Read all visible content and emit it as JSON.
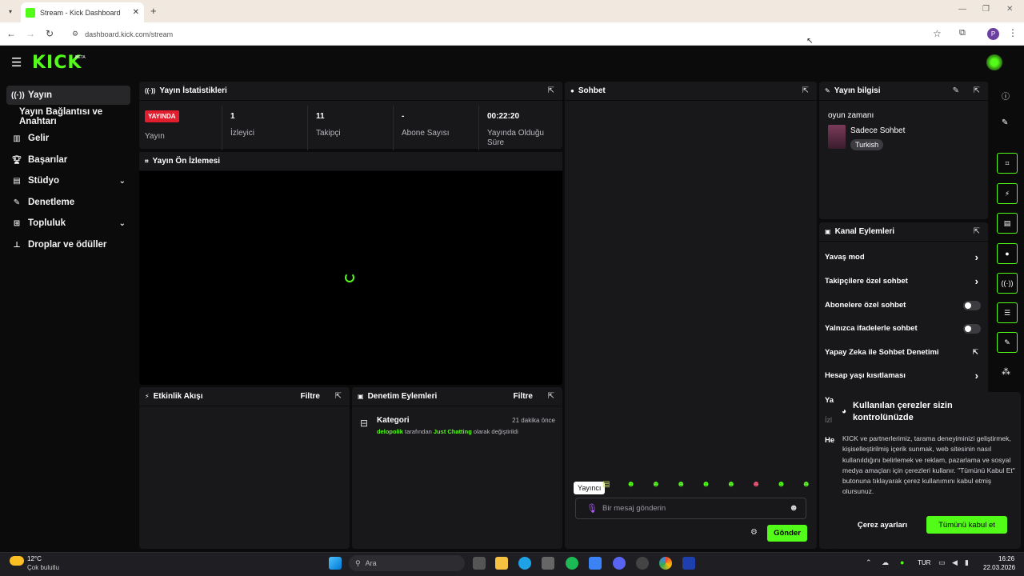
{
  "browser": {
    "tab_title": "Stream - Kick Dashboard",
    "url": "dashboard.kick.com/stream",
    "profile_initial": "P"
  },
  "app": {
    "logo": "KICK",
    "logo_badge": "BETA"
  },
  "sidebar": {
    "items": [
      {
        "label": "Yayın",
        "icon": "broadcast-icon",
        "active": true
      },
      {
        "label": "Yayın Bağlantısı ve Anahtarı",
        "icon": "",
        "active": false
      },
      {
        "label": "Gelir",
        "icon": "chart-icon"
      },
      {
        "label": "Başarılar",
        "icon": "trophy-icon"
      },
      {
        "label": "Stüdyo",
        "icon": "studio-icon",
        "chevron": true
      },
      {
        "label": "Denetleme",
        "icon": "wrench-icon"
      },
      {
        "label": "Topluluk",
        "icon": "community-icon",
        "chevron": true
      },
      {
        "label": "Droplar ve ödüller",
        "icon": "drops-icon"
      }
    ]
  },
  "stats": {
    "title": "Yayın İstatistikleri",
    "live_badge": "YAYINDA",
    "live_label": "Yayın",
    "viewers_value": "1",
    "viewers_label": "İzleyici",
    "followers_value": "11",
    "followers_label": "Takipçi",
    "subs_value": "-",
    "subs_label": "Abone Sayısı",
    "duration_value": "00:22:20",
    "duration_label": "Yayında Olduğu Süre"
  },
  "preview": {
    "title": "Yayın Ön İzlemesi"
  },
  "activity": {
    "title": "Etkinlik Akışı",
    "filter": "Filtre"
  },
  "moderation": {
    "title": "Denetim Eylemleri",
    "filter": "Filtre",
    "entry_title": "Kategori",
    "entry_time": "21 dakika önce",
    "entry_user": "delopolik",
    "entry_mid": "tarafından",
    "entry_category": "Just Chatting",
    "entry_end": "olarak değiştirildi"
  },
  "chat": {
    "title": "Sohbet",
    "tooltip": "Yayıncı",
    "placeholder": "Bir mesaj gönderin",
    "send": "Gönder"
  },
  "stream_info": {
    "title": "Yayın bilgisi",
    "stream_title": "oyun zamanı",
    "category": "Sadece Sohbet",
    "language": "Turkish"
  },
  "channel_actions": {
    "title": "Kanal Eylemleri",
    "items": [
      {
        "label": "Yavaş mod",
        "control": "chevron"
      },
      {
        "label": "Takipçilere özel sohbet",
        "control": "chevron"
      },
      {
        "label": "Abonelere özel sohbet",
        "control": "toggle"
      },
      {
        "label": "Yalnızca ifadelerle sohbet",
        "control": "toggle"
      },
      {
        "label": "Yapay Zeka ile Sohbet Denetimi",
        "control": "external"
      },
      {
        "label": "Hesap yaşı kısıtlaması",
        "control": "chevron"
      }
    ],
    "partial_1": "Ya",
    "partial_2": "İzl",
    "partial_3": "He"
  },
  "cookie": {
    "title": "Kullanılan çerezler sizin kontrolünüzde",
    "body": "KICK ve partnerlerimiz, tarama deneyiminizi geliştirmek, kişiselleştirilmiş içerik sunmak, web sitesinin nasıl kullanıldığını belirlemek ve reklam, pazarlama ve sosyal medya amaçları için çerezleri kullanır. \"Tümünü Kabul Et\" butonuna tıklayarak çerez kullanımını kabul etmiş olursunuz.",
    "settings": "Çerez ayarları",
    "accept": "Tümünü kabul et"
  },
  "taskbar": {
    "temp": "12°C",
    "weather": "Çok bulutlu",
    "search": "Ara",
    "lang": "TUR",
    "time": "16:26",
    "date": "22.03.2026"
  },
  "colors": {
    "accent": "#53fc18",
    "live": "#e11d2e",
    "panel": "#18181b"
  }
}
